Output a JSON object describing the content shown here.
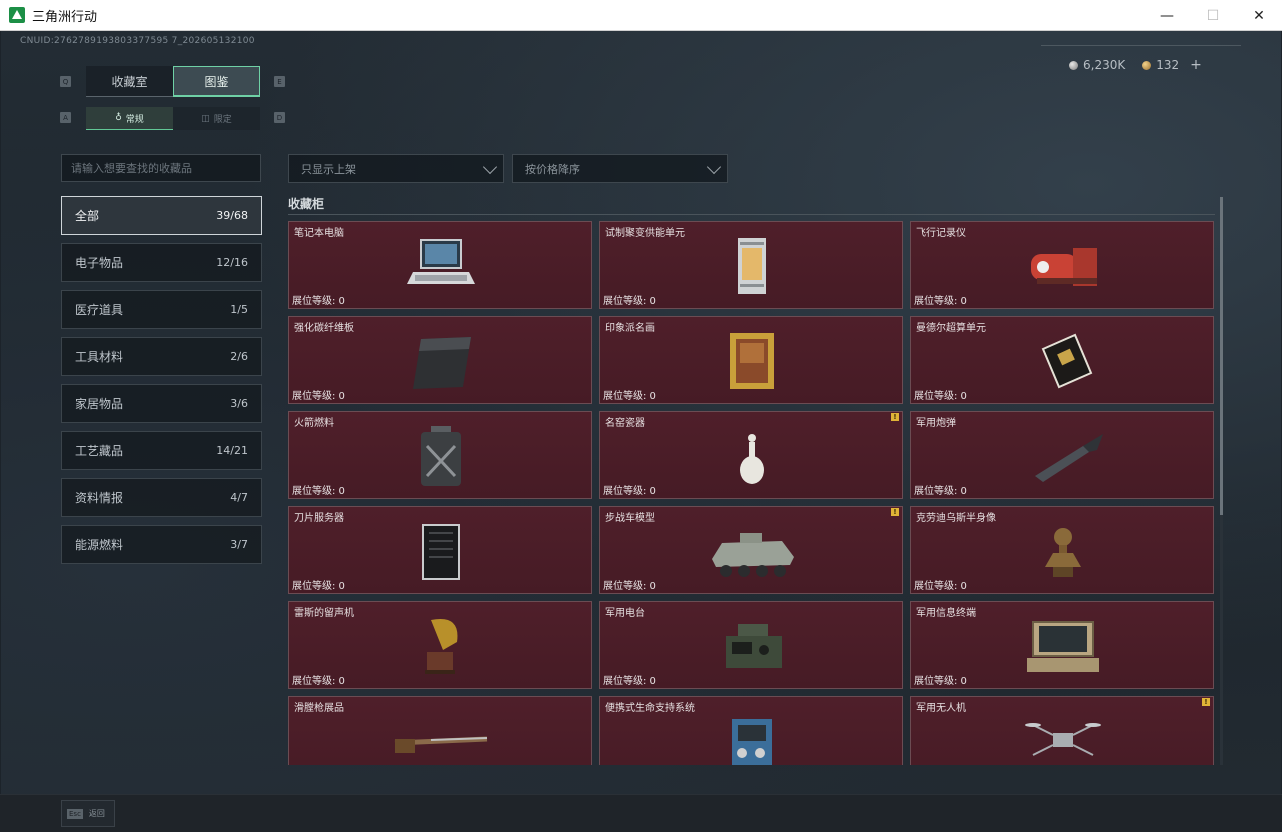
{
  "window": {
    "title": "三角洲行动",
    "controls": {
      "minimize": "—",
      "maximize": "☐",
      "close": "✕"
    }
  },
  "header": {
    "uid": "CNUID:2762789193803377595 7_202605132100",
    "currency": {
      "silver": "6,230K",
      "gold": "132",
      "add": "+"
    },
    "key_prev_tab": "Q",
    "key_next_tab": "E",
    "key_prev_sub": "A",
    "key_next_sub": "D"
  },
  "tabs": [
    {
      "label": "收藏室",
      "active": false
    },
    {
      "label": "图鉴",
      "active": true
    }
  ],
  "sub_tabs": [
    {
      "label": "常规",
      "icon": "♁",
      "active": true
    },
    {
      "label": "限定",
      "icon": "◫",
      "active": false
    }
  ],
  "search": {
    "placeholder": "请输入想要查找的收藏品"
  },
  "filters": {
    "show": "只显示上架",
    "sort": "按价格降序"
  },
  "categories": [
    {
      "label": "全部",
      "count": "39/68",
      "active": true
    },
    {
      "label": "电子物品",
      "count": "12/16"
    },
    {
      "label": "医疗道具",
      "count": "1/5"
    },
    {
      "label": "工具材料",
      "count": "2/6"
    },
    {
      "label": "家居物品",
      "count": "3/6"
    },
    {
      "label": "工艺藏品",
      "count": "14/21"
    },
    {
      "label": "资料情报",
      "count": "4/7"
    },
    {
      "label": "能源燃料",
      "count": "3/7"
    }
  ],
  "section": {
    "title": "收藏柜"
  },
  "items": [
    {
      "name": "笔记本电脑",
      "level": "展位等级: 0",
      "icon": "laptop-icon",
      "badge": ""
    },
    {
      "name": "试制聚变供能单元",
      "level": "展位等级: 0",
      "icon": "fusion-cell-icon",
      "badge": ""
    },
    {
      "name": "飞行记录仪",
      "level": "展位等级: 0",
      "icon": "flight-recorder-icon",
      "badge": ""
    },
    {
      "name": "强化碳纤维板",
      "level": "展位等级: 0",
      "icon": "carbon-plate-icon",
      "badge": ""
    },
    {
      "name": "印象派名画",
      "level": "展位等级: 0",
      "icon": "painting-icon",
      "badge": ""
    },
    {
      "name": "曼德尔超算单元",
      "level": "展位等级: 0",
      "icon": "supercomputer-unit-icon",
      "badge": ""
    },
    {
      "name": "火箭燃料",
      "level": "展位等级: 0",
      "icon": "fuel-canister-icon",
      "badge": ""
    },
    {
      "name": "名窑瓷器",
      "level": "展位等级: 0",
      "icon": "porcelain-vase-icon",
      "badge": "!"
    },
    {
      "name": "军用炮弹",
      "level": "展位等级: 0",
      "icon": "artillery-shell-icon",
      "badge": ""
    },
    {
      "name": "刀片服务器",
      "level": "展位等级: 0",
      "icon": "blade-server-icon",
      "badge": ""
    },
    {
      "name": "步战车模型",
      "level": "展位等级: 0",
      "icon": "ifv-model-icon",
      "badge": "!"
    },
    {
      "name": "克劳迪乌斯半身像",
      "level": "展位等级: 0",
      "icon": "bust-icon",
      "badge": ""
    },
    {
      "name": "雷斯的留声机",
      "level": "展位等级: 0",
      "icon": "gramophone-icon",
      "badge": ""
    },
    {
      "name": "军用电台",
      "level": "展位等级: 0",
      "icon": "military-radio-icon",
      "badge": ""
    },
    {
      "name": "军用信息终端",
      "level": "展位等级: 0",
      "icon": "info-terminal-icon",
      "badge": ""
    },
    {
      "name": "滑膛枪展品",
      "level": "",
      "icon": "musket-icon",
      "badge": ""
    },
    {
      "name": "便携式生命支持系统",
      "level": "",
      "icon": "life-support-icon",
      "badge": ""
    },
    {
      "name": "军用无人机",
      "level": "",
      "icon": "drone-icon",
      "badge": "!"
    }
  ],
  "footer": {
    "esc_key": "Esc",
    "esc_label": "返回"
  },
  "colors": {
    "accent": "#6fd1a6",
    "card_bg": "#4f1f2a",
    "badge": "#e0b437"
  }
}
